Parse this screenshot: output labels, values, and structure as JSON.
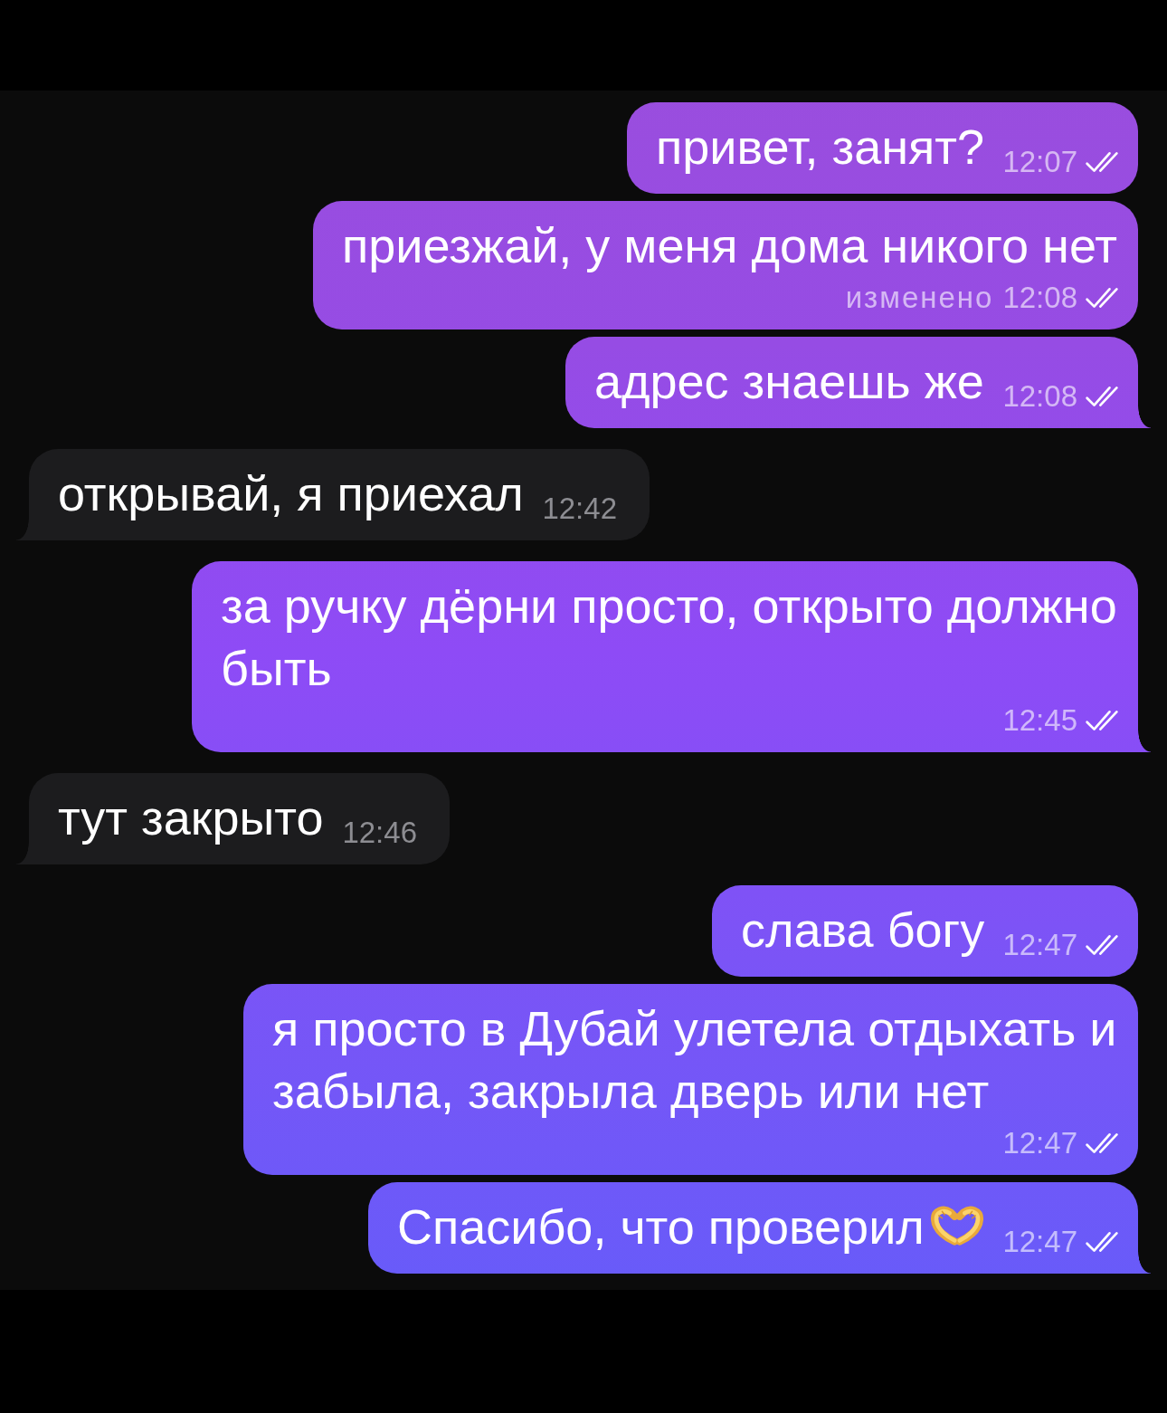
{
  "messages": [
    {
      "kind": "outgoing",
      "text": "привет, занят?",
      "time": "12:07",
      "read": true,
      "tail": false
    },
    {
      "kind": "outgoing",
      "text": "приезжай, у меня дома никого нет",
      "edited_label": "изменено",
      "time": "12:08",
      "read": true,
      "tail": false
    },
    {
      "kind": "outgoing",
      "text": "адрес знаешь же",
      "time": "12:08",
      "read": true,
      "tail": true
    },
    {
      "kind": "incoming",
      "text": "открывай, я приехал",
      "time": "12:42",
      "tail": true
    },
    {
      "kind": "outgoing",
      "text": "за ручку дёрни просто, открыто должно быть",
      "time": "12:45",
      "read": true,
      "tail": true
    },
    {
      "kind": "incoming",
      "text": "тут закрыто",
      "time": "12:46",
      "tail": true
    },
    {
      "kind": "outgoing",
      "text": "слава богу",
      "time": "12:47",
      "read": true,
      "tail": false
    },
    {
      "kind": "outgoing",
      "text": "я просто в Дубай улетела отдыхать и забыла, закрыла дверь или нет",
      "time": "12:47",
      "read": true,
      "tail": false
    },
    {
      "kind": "outgoing",
      "text": "Спасибо, что проверил",
      "emoji": true,
      "time": "12:47",
      "read": true,
      "tail": true
    }
  ]
}
